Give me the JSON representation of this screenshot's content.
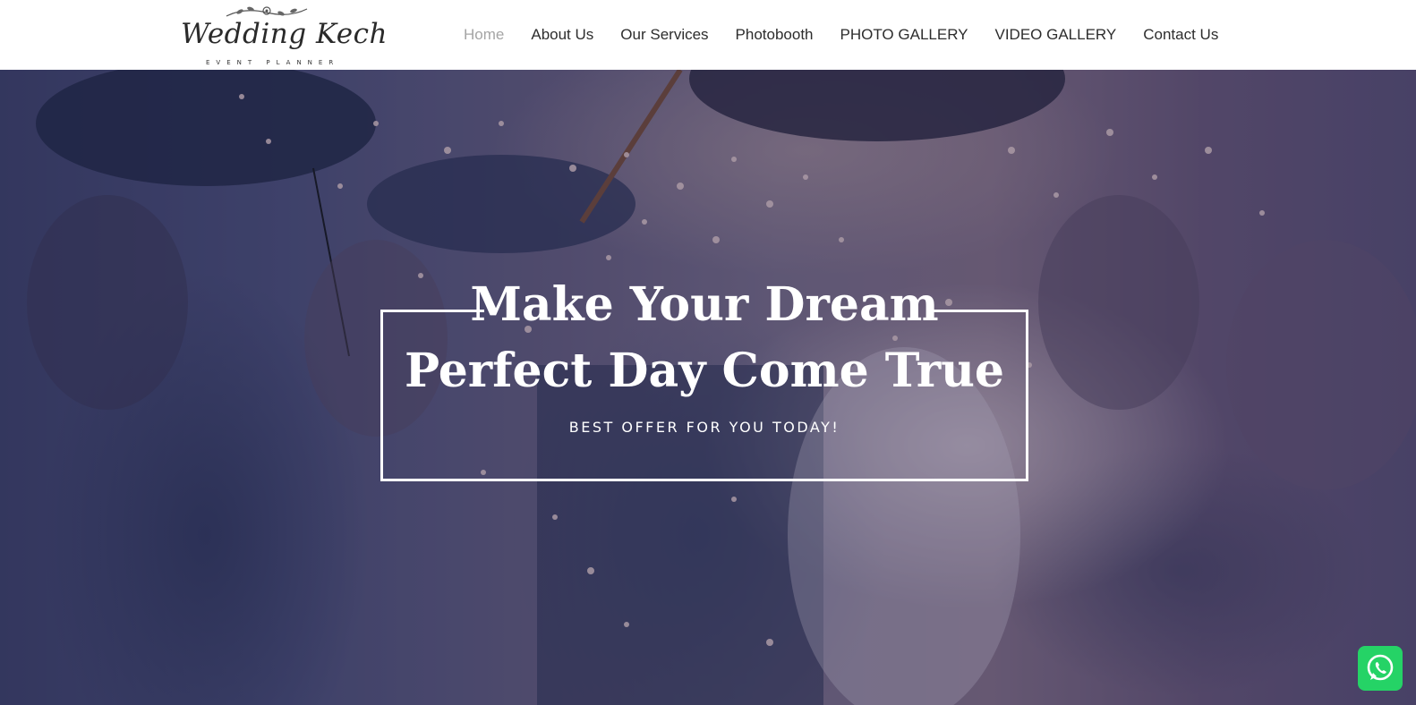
{
  "logo": {
    "script": "Wedding Kech",
    "subtitle": "EVENT PLANNER"
  },
  "nav": {
    "items": [
      {
        "label": "Home",
        "active": true
      },
      {
        "label": "About Us"
      },
      {
        "label": "Our Services"
      },
      {
        "label": "Photobooth"
      },
      {
        "label": "PHOTO GALLERY"
      },
      {
        "label": "VIDEO GALLERY"
      },
      {
        "label": "Contact Us"
      }
    ]
  },
  "hero": {
    "title_line1": "Make Your Dream",
    "title_line2": "Perfect Day Come True",
    "subtitle": "BEST OFFER FOR YOU TODAY!"
  },
  "widgets": {
    "chat_icon": "whatsapp-icon",
    "chat_color": "#25d366"
  },
  "colors": {
    "nav_text": "#2d2d2d",
    "nav_active": "#a5a5a5",
    "hero_text": "#ffffff"
  }
}
